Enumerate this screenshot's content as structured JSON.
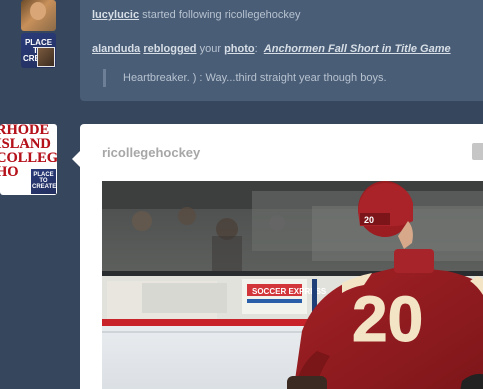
{
  "notifications": [
    {
      "user": "lucylucic",
      "action": "started following",
      "target": "ricollegehockey"
    },
    {
      "user": "alanduda",
      "action": "reblogged",
      "possessive": "your",
      "object": "photo",
      "separator": ":",
      "post_title": "Anchormen Fall Short in Title Game",
      "quote": "Heartbreaker. ) : Way...third straight year though boys."
    }
  ],
  "avatars": {
    "alanduda_text": "PLACE TO CREATE",
    "ricollegehockey_text": "RHODE ISLAND COLLEGE HO",
    "small_avatar_text": "PLACE TO CREATE"
  },
  "post": {
    "author": "ricollegehockey",
    "photo": {
      "jersey_number": "20",
      "helmet_number": "20",
      "board_ad": "SOCCER EXPRESS"
    }
  },
  "colors": {
    "dashboard_bg": "#36465d",
    "notification_bg": "#495d77",
    "post_bg": "#ffffff",
    "jersey": "#8e1c1e",
    "jersey_trim": "#f4e4c6"
  }
}
